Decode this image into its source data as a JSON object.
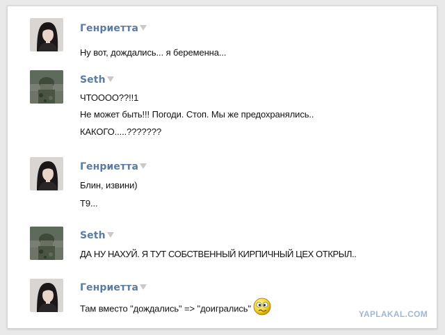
{
  "messages": [
    {
      "author": "Генриетта",
      "avatar": "female-avatar",
      "lines": [
        "Ну вот, дождались... я беременна..."
      ]
    },
    {
      "author": "Seth",
      "avatar": "soldier-avatar",
      "lines": [
        "ЧТОООО??!!1",
        "Не может быть!!! Погоди. Стоп. Мы же предохранялись..",
        "КАКОГО.....???????"
      ]
    },
    {
      "author": "Генриетта",
      "avatar": "female-avatar",
      "lines": [
        "Блин, извини)",
        "Т9..."
      ]
    },
    {
      "author": "Seth",
      "avatar": "soldier-avatar",
      "lines": [
        "ДА НУ НАХУЙ. Я ТУТ СОБСТВЕННЫЙ КИРПИЧНЫЙ ЦЕХ ОТКРЫЛ.."
      ]
    },
    {
      "author": "Генриетта",
      "avatar": "female-avatar",
      "lines": [
        "Там вместо \"дождались\" => \"доигрались\""
      ],
      "emoji": "confused-smiley-icon"
    }
  ],
  "watermark": "YAPLAKAL.COM",
  "colors": {
    "author_name": "#5c7b9f",
    "message_text": "#111111",
    "watermark": "#9fb7d4",
    "caret": "#c9c9c9"
  }
}
